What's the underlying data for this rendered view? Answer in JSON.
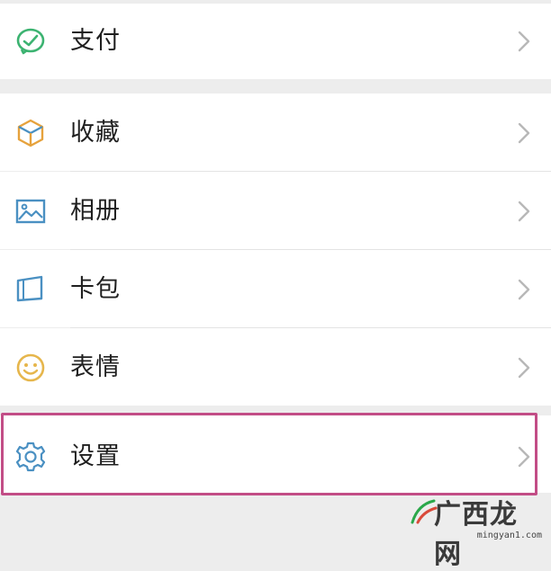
{
  "menu": {
    "items": [
      {
        "label": "支付",
        "icon": "wechat-pay-icon",
        "color": "#3cb371"
      },
      {
        "label": "收藏",
        "icon": "cube-icon",
        "color": "#e6a23c"
      },
      {
        "label": "相册",
        "icon": "picture-icon",
        "color": "#4a90c2"
      },
      {
        "label": "卡包",
        "icon": "card-wallet-icon",
        "color": "#4a90c2"
      },
      {
        "label": "表情",
        "icon": "smile-icon",
        "color": "#e6b64c"
      },
      {
        "label": "设置",
        "icon": "gear-icon",
        "color": "#4a90c2"
      }
    ]
  },
  "highlight_color": "#c24d86",
  "watermark": {
    "text": "广西龙网",
    "url": "mingyan1.com"
  }
}
